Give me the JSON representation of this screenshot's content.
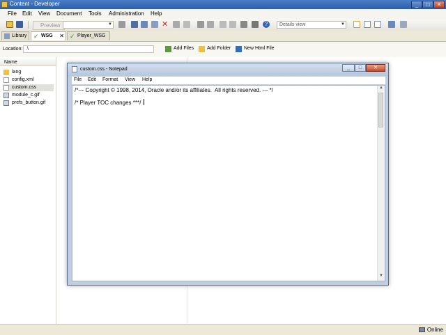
{
  "app": {
    "title": "Content - Developer",
    "window_buttons": [
      "_",
      "□",
      "✕"
    ]
  },
  "menubar": [
    "File",
    "Edit",
    "View",
    "Document",
    "Tools",
    "Administration",
    "Help"
  ],
  "toolbar": {
    "preview_label": "Preview",
    "view_combo": "Details view"
  },
  "tabs": [
    {
      "label": "Library",
      "active": false
    },
    {
      "label": "WSG",
      "active": true
    },
    {
      "label": "Player_WSG",
      "active": false
    }
  ],
  "location": {
    "label": "Location:",
    "value": ".\\",
    "buttons": [
      "Add Files",
      "Add Folder",
      "New Html File"
    ]
  },
  "file_panel": {
    "header": "Name",
    "items": [
      {
        "name": "lang",
        "type": "folder"
      },
      {
        "name": "config.xml",
        "type": "file"
      },
      {
        "name": "custom.css",
        "type": "file",
        "selected": true
      },
      {
        "name": "module_c.gif",
        "type": "image"
      },
      {
        "name": "prefs_button.gif",
        "type": "image"
      }
    ]
  },
  "status": {
    "text": "Online"
  },
  "notepad": {
    "title": "custom.css - Notepad",
    "menu": [
      "File",
      "Edit",
      "Format",
      "View",
      "Help"
    ],
    "lines": [
      "/*--- Copyright © 1998, 2014, Oracle and/or its affiliates.  All rights reserved. --- */",
      "/* Player TOC changes ***/ "
    ],
    "window_buttons": [
      "_",
      "□",
      "✕"
    ]
  }
}
